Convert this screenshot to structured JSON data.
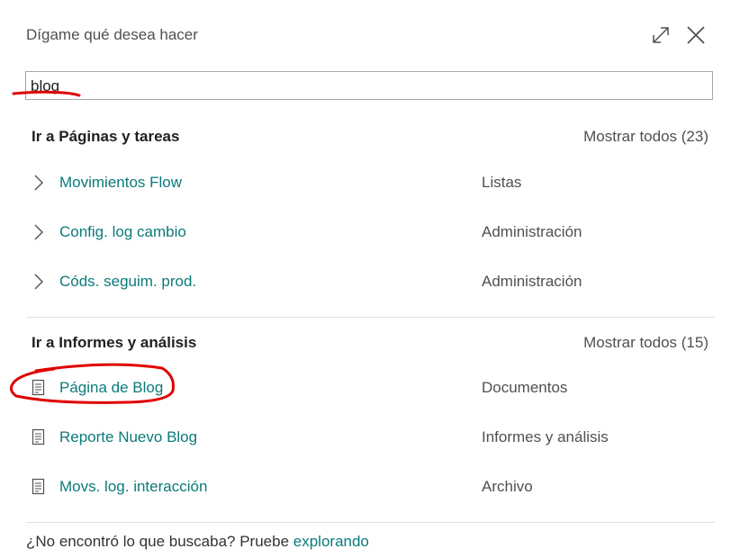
{
  "header": {
    "title": "Dígame qué desea hacer"
  },
  "search": {
    "value": "blog"
  },
  "sections": {
    "pages": {
      "title": "Ir a Páginas y tareas",
      "show_all": "Mostrar todos (23)",
      "items": [
        {
          "name": "Movimientos Flow",
          "category": "Listas"
        },
        {
          "name": "Config. log cambio",
          "category": "Administración"
        },
        {
          "name": "Códs. seguim. prod.",
          "category": "Administración"
        }
      ]
    },
    "reports": {
      "title": "Ir a Informes y análisis",
      "show_all": "Mostrar todos (15)",
      "items": [
        {
          "name": "Página de Blog",
          "category": "Documentos"
        },
        {
          "name": "Reporte Nuevo Blog",
          "category": "Informes y análisis"
        },
        {
          "name": "Movs. log. interacción",
          "category": "Archivo"
        }
      ]
    }
  },
  "footer": {
    "text": "¿No encontró lo que buscaba? Pruebe ",
    "link": "explorando"
  },
  "colors": {
    "accent": "#0c7a7a",
    "annotation": "#e00000"
  }
}
